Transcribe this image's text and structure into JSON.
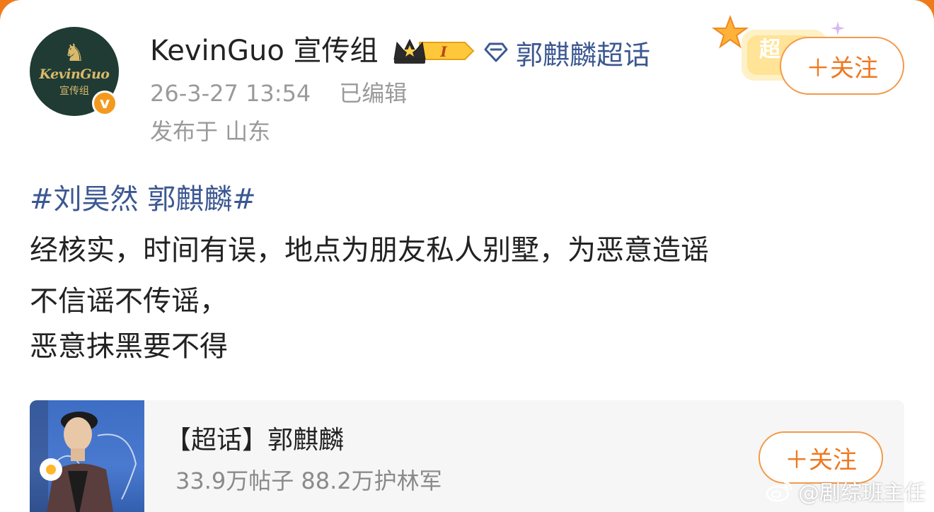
{
  "post": {
    "author": {
      "avatar_logo_text": "KevinGuo",
      "avatar_logo_cn": "宣传组",
      "avatar_mark": "♞",
      "verified_mark": "v",
      "name": "KevinGuo 宣传组",
      "vip_badge_level": "I"
    },
    "topic_link": "郭麒麟超话",
    "timestamp": "26-3-27 13:54",
    "edited": "已编辑",
    "location": "发布于 山东",
    "follow_label": "＋关注",
    "decor_label": "超",
    "hashtag": "#刘昊然 郭麒麟#",
    "lines": [
      "经核实，时间有误，地点为朋友私人别墅，为恶意造谣",
      "不信谣不传谣，",
      "恶意抹黑要不得"
    ]
  },
  "super_topic": {
    "title": "【超话】郭麒麟",
    "stats": "33.9万帖子 88.2万护林军",
    "follow_label": "＋关注"
  },
  "watermark": "@剧综班主任",
  "colors": {
    "accent_orange": "#f0781e",
    "link_blue": "#3c5891",
    "avatar_green": "#1f3b34"
  },
  "icons": [
    "crown-icon",
    "diamond-icon",
    "verified-icon",
    "weibo-icon"
  ]
}
